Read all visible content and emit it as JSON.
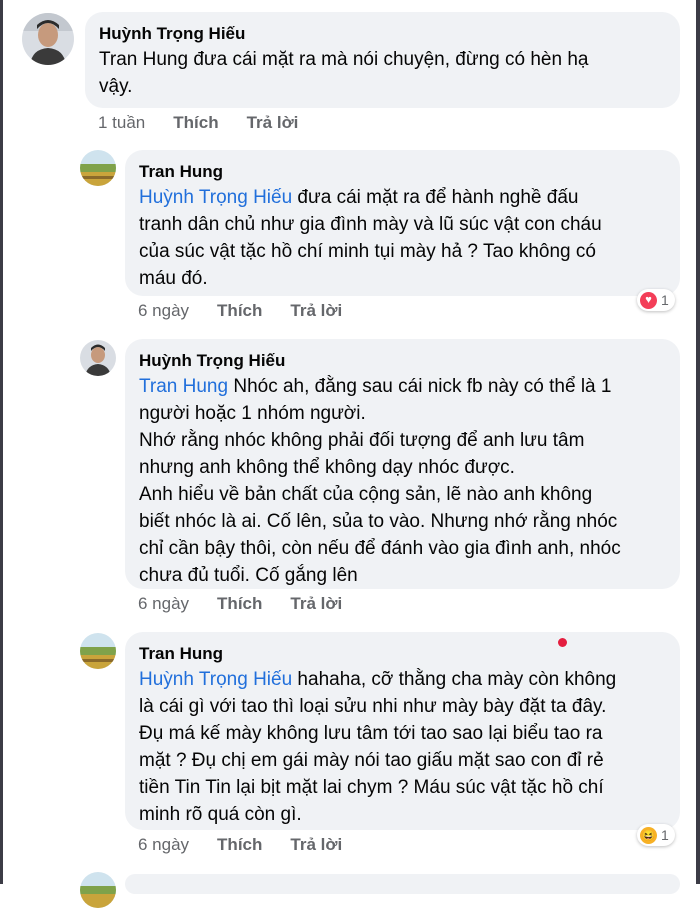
{
  "comments": [
    {
      "author": "Huỳnh Trọng Hiếu",
      "mention": "",
      "text": "Tran Hung đưa cái mặt ra mà nói chuyện, đừng có hèn hạ\nvậy.",
      "time": "1 tuần",
      "like_label": "Thích",
      "reply_label": "Trả lời",
      "avatar_icon": "person-photo-icon"
    },
    {
      "author": "Tran Hung",
      "mention": "Huỳnh Trọng Hiếu",
      "text": " đưa cái mặt ra để hành nghề đấu\ntranh dân chủ như gia đình mày và lũ súc vật con cháu\ncủa súc vật tặc hồ chí minh tụi mày hả ? Tao không có\nmáu đó.",
      "time": "6 ngày",
      "like_label": "Thích",
      "reply_label": "Trả lời",
      "avatar_icon": "landscape-photo-icon",
      "reaction": {
        "icon": "heart-icon",
        "count": "1",
        "color": "#f33e58"
      }
    },
    {
      "author": "Huỳnh Trọng Hiếu",
      "mention": "Tran Hung",
      "text": " Nhóc ah, đằng sau cái nick fb này có thể là 1\nngười hoặc 1 nhóm người.\nNhớ rằng nhóc không phải đối tượng để anh lưu tâm\nnhưng anh không thể không dạy nhóc được.\nAnh hiểu về bản chất của cộng sản, lẽ nào anh không\nbiết nhóc là ai. Cố lên, sủa to vào. Nhưng nhớ rằng nhóc\nchỉ cần bậy thôi, còn nếu để đánh vào gia đình anh, nhóc\nchưa đủ tuổi. Cố gắng lên",
      "time": "6 ngày",
      "like_label": "Thích",
      "reply_label": "Trả lời",
      "avatar_icon": "person-photo-icon"
    },
    {
      "author": "Tran Hung",
      "mention": "Huỳnh Trọng Hiếu",
      "text": " hahaha, cỡ thằng cha mày còn không\nlà cái gì với tao thì loại sửu nhi như mày bày đặt ta đây.\nĐụ má kế mày không lưu tâm tới tao sao lại biểu tao ra\nmặt ? Đụ chị em gái mày nói tao giấu mặt sao con đỉ rẻ\ntiền Tin Tin lại bịt mặt lai chym ? Máu súc vật tặc hồ chí\nminh rõ quá còn gì.",
      "time": "6 ngày",
      "like_label": "Thích",
      "reply_label": "Trả lời",
      "avatar_icon": "landscape-photo-icon",
      "reaction": {
        "icon": "haha-icon",
        "count": "1",
        "color": "#f7b125"
      }
    }
  ],
  "colors": {
    "mention": "#216fdb",
    "bubble": "#f0f2f5",
    "meta": "#65676b"
  }
}
